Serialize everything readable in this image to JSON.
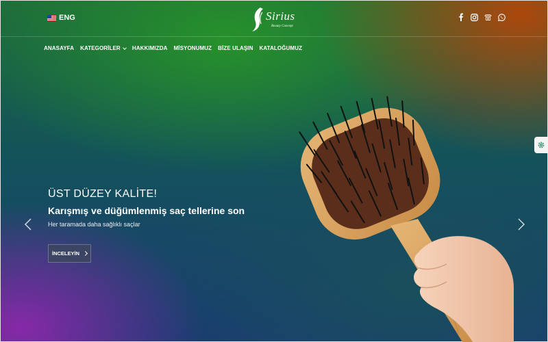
{
  "header": {
    "language_label": "ENG",
    "logo": {
      "name": "Sirius",
      "tagline": "Beauty Concept"
    },
    "social_icons": [
      "facebook-icon",
      "instagram-icon",
      "phone-icon",
      "whatsapp-icon"
    ]
  },
  "nav": {
    "items": [
      {
        "label": "ANASAYFA"
      },
      {
        "label": "KATEGORİLER",
        "has_dropdown": true
      },
      {
        "label": "HAKKIMIZDA"
      },
      {
        "label": "MİSYONUMUZ"
      },
      {
        "label": "BİZE ULAŞIN"
      },
      {
        "label": "KATALOĞUMUZ"
      }
    ]
  },
  "hero": {
    "title": "ÜST DÜZEY KALİTE!",
    "subtitle": "Karışmış ve düğümlenmiş saç tellerine son",
    "description": "Her taramada daha sağlıklı saçlar",
    "cta_label": "İNCELEYİN"
  },
  "colors": {
    "text": "#ffffff",
    "cta_bg": "#3c465f",
    "brush_wood": "#d9a35c",
    "brush_pad": "#5a2e1a",
    "skin": "#f1c6a8"
  }
}
